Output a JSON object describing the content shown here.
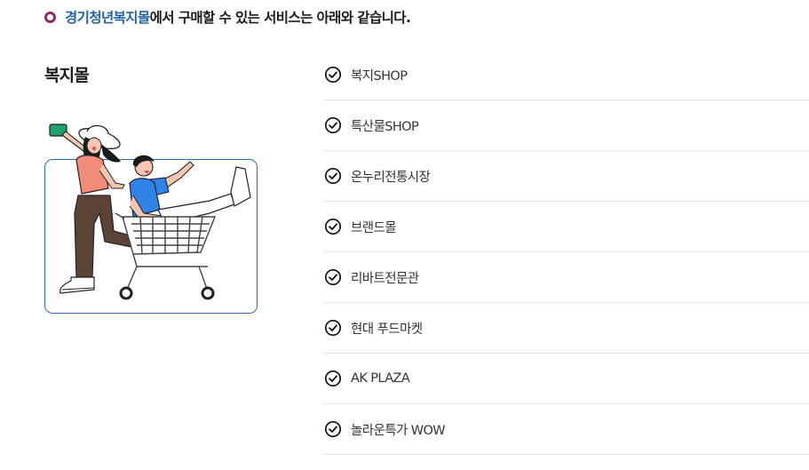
{
  "heading": {
    "highlight": "경기청년복지몰",
    "rest": "에서 구매할 수 있는 서비스는 아래와 같습니다."
  },
  "section_title": "복지몰",
  "illustration": {
    "icon": "shopping-cart-illustration"
  },
  "services": [
    {
      "label": "복지SHOP"
    },
    {
      "label": "특산물SHOP"
    },
    {
      "label": "온누리전통시장"
    },
    {
      "label": "브랜드몰"
    },
    {
      "label": "리바트전문관"
    },
    {
      "label": "현대 푸드마켓"
    },
    {
      "label": "AK PLAZA"
    },
    {
      "label": "놀라운특가 WOW"
    }
  ],
  "colors": {
    "accent_text": "#2463a8",
    "bullet": "#8a2a6a",
    "box_border": "#2c6cb4"
  }
}
